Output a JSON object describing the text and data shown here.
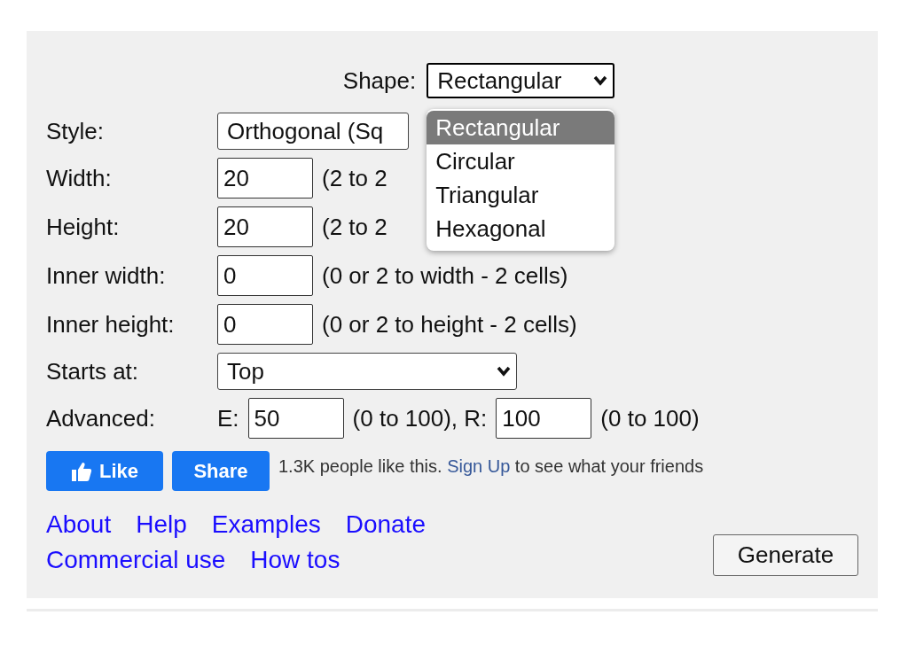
{
  "shape": {
    "label": "Shape:",
    "value": "Rectangular",
    "expanded": true,
    "options": [
      {
        "label": "Rectangular",
        "selected": true
      },
      {
        "label": "Circular",
        "selected": false
      },
      {
        "label": "Triangular",
        "selected": false
      },
      {
        "label": "Hexagonal",
        "selected": false
      }
    ]
  },
  "fields": [
    {
      "kind": "cut_select",
      "label": "Style:",
      "value": "Orthogonal (Sq"
    },
    {
      "kind": "input",
      "label": "Width:",
      "value": "20",
      "hint": "(2 to 2"
    },
    {
      "kind": "input",
      "label": "Height:",
      "value": "20",
      "hint": "(2 to 2"
    },
    {
      "kind": "input",
      "label": "Inner width:",
      "value": "0",
      "hint": "(0 or 2 to width - 2 cells)"
    },
    {
      "kind": "input",
      "label": "Inner height:",
      "value": "0",
      "hint": "(0 or 2 to height - 2 cells)"
    },
    {
      "kind": "select",
      "label": "Starts at:",
      "value": "Top"
    }
  ],
  "advanced": {
    "label": "Advanced:",
    "e_label": "E:",
    "e_value": "50",
    "e_hint": "(0 to 100), R:",
    "r_value": "100",
    "r_hint": "(0 to 100)"
  },
  "social": {
    "like": "Like",
    "share": "Share",
    "text_before": "1.3K people like this.",
    "link": "Sign Up",
    "text_after": "to see what your friends"
  },
  "links": [
    [
      "About",
      "Help",
      "Examples",
      "Donate"
    ],
    [
      "Commercial use",
      "How tos"
    ]
  ],
  "generate": "Generate"
}
